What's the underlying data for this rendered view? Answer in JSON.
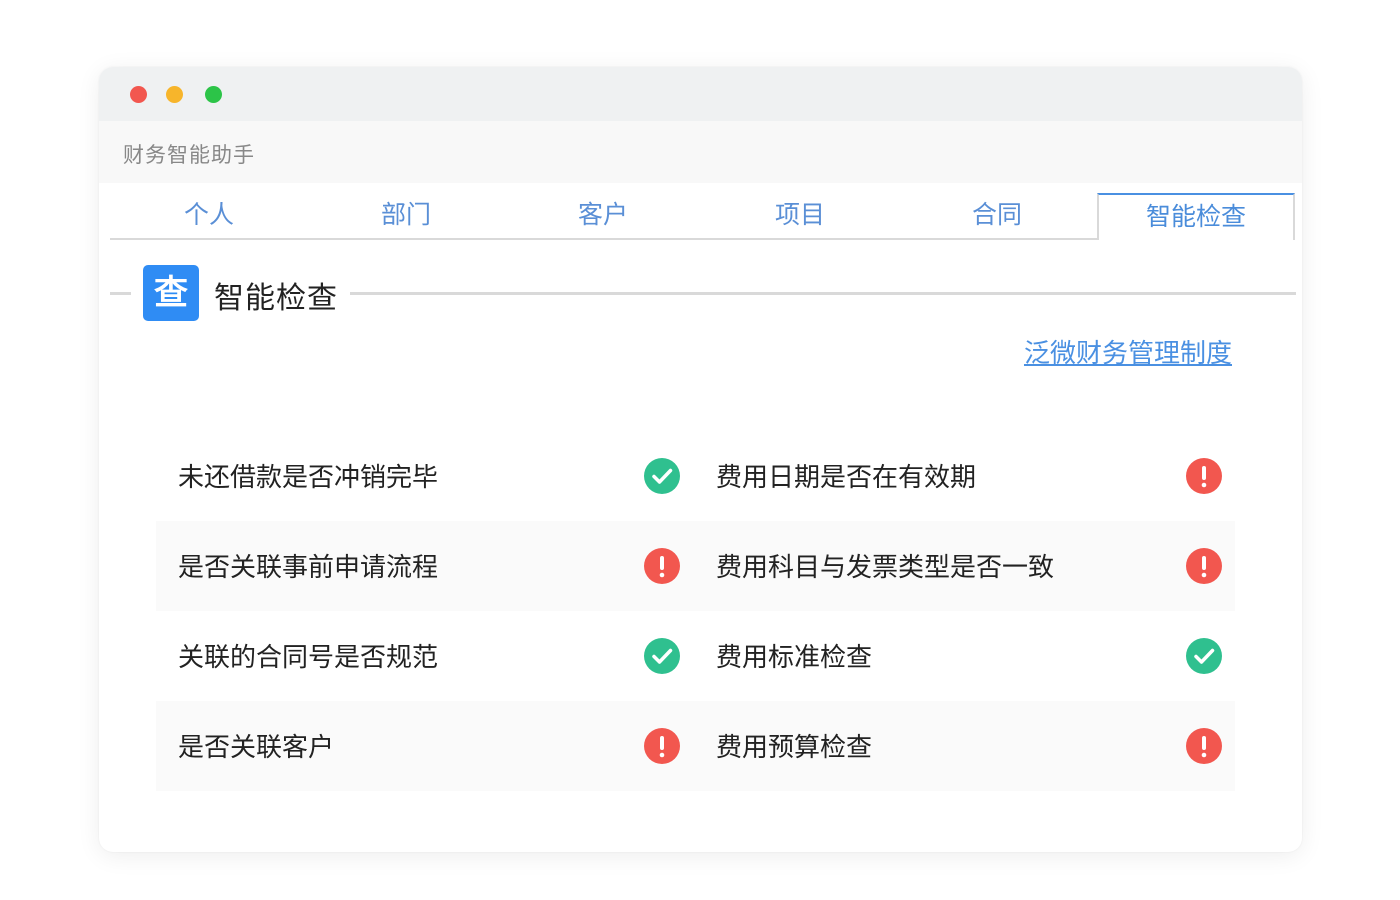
{
  "app": {
    "title": "财务智能助手"
  },
  "tabs": [
    {
      "label": "个人",
      "active": false
    },
    {
      "label": "部门",
      "active": false
    },
    {
      "label": "客户",
      "active": false
    },
    {
      "label": "项目",
      "active": false
    },
    {
      "label": "合同",
      "active": false
    },
    {
      "label": "智能检查",
      "active": true
    }
  ],
  "section": {
    "icon_glyph": "查",
    "icon": "search-doc-icon",
    "title": "智能检查"
  },
  "policy_link": {
    "label": "泛微财务管理制度"
  },
  "checks": [
    {
      "left": {
        "label": "未还借款是否冲销完毕",
        "status": "ok"
      },
      "right": {
        "label": "费用日期是否在有效期",
        "status": "warn"
      }
    },
    {
      "left": {
        "label": "是否关联事前申请流程",
        "status": "warn"
      },
      "right": {
        "label": "费用科目与发票类型是否一致",
        "status": "warn"
      }
    },
    {
      "left": {
        "label": "关联的合同号是否规范",
        "status": "ok"
      },
      "right": {
        "label": "费用标准检查",
        "status": "ok"
      }
    },
    {
      "left": {
        "label": "是否关联客户",
        "status": "warn"
      },
      "right": {
        "label": "费用预算检查",
        "status": "warn"
      }
    }
  ],
  "colors": {
    "accent": "#4a90e2",
    "ok": "#2fc08f",
    "warn": "#f2574f",
    "icon_bg": "#2f8cf4"
  }
}
